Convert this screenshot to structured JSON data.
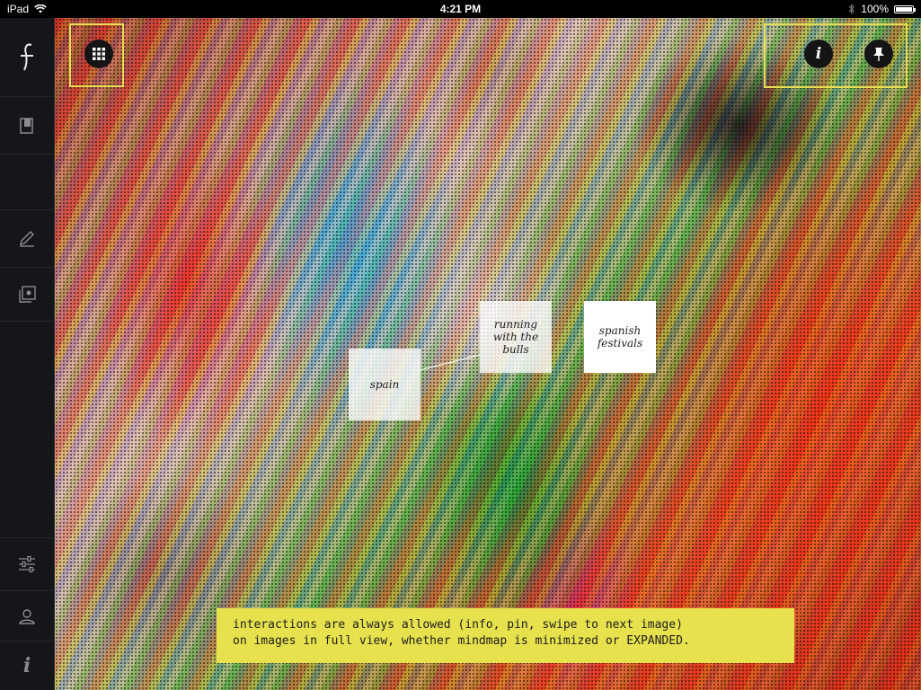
{
  "status_bar": {
    "device": "iPad",
    "time": "4:21 PM",
    "battery": "100%",
    "battery_level": 1.0
  },
  "sidebar": {
    "items": [
      {
        "name": "logo-icon"
      },
      {
        "name": "book-icon"
      },
      {
        "name": "blank"
      },
      {
        "name": "pencil-icon"
      },
      {
        "name": "pinboard-icon"
      },
      {
        "name": "sliders-icon"
      },
      {
        "name": "user-icon"
      },
      {
        "name": "info-icon",
        "glyph": "i"
      }
    ]
  },
  "photo_toolbar": {
    "grid_button": "grid-icon",
    "info_button_glyph": "i",
    "pin_button": "pin-icon"
  },
  "mindmap": {
    "nodes": [
      {
        "label": "spain",
        "state": "faded"
      },
      {
        "label": "running with the bulls",
        "state": "faded"
      },
      {
        "label": "spanish festivals",
        "state": "active"
      }
    ]
  },
  "annotation": {
    "line1": "interactions are always allowed (info, pin, swipe to next image)",
    "line2": "on images in full view, whether mindmap is minimized or EXPANDED."
  },
  "colors": {
    "highlight": "#e9dd54",
    "annotation_bg": "#e7e14e",
    "sidebar_bg": "#151619"
  }
}
